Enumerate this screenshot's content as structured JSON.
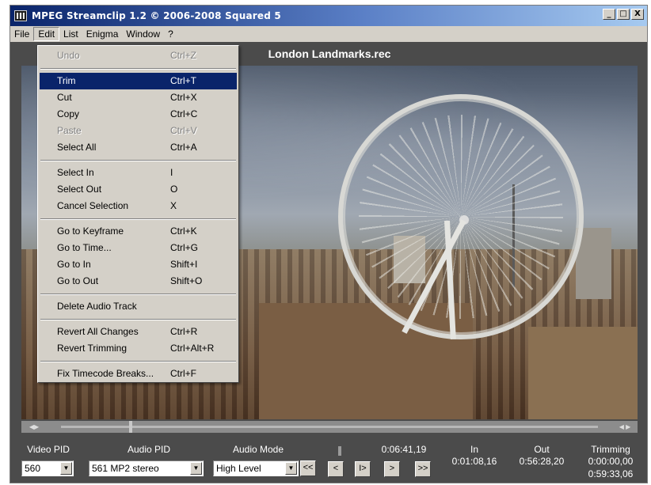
{
  "window": {
    "title": "MPEG Streamclip 1.2  ©  2006-2008 Squared 5",
    "buttons": [
      "_",
      "□",
      "X"
    ]
  },
  "menubar": [
    "File",
    "Edit",
    "List",
    "Enigma",
    "Window",
    "?"
  ],
  "video_title": "London Landmarks.rec",
  "edit_menu": {
    "items": [
      {
        "label": "Undo",
        "shortcut": "Ctrl+Z",
        "state": "disabled"
      },
      {
        "sep": true
      },
      {
        "label": "Trim",
        "shortcut": "Ctrl+T",
        "state": "highlighted"
      },
      {
        "label": "Cut",
        "shortcut": "Ctrl+X",
        "state": "enabled"
      },
      {
        "label": "Copy",
        "shortcut": "Ctrl+C",
        "state": "enabled"
      },
      {
        "label": "Paste",
        "shortcut": "Ctrl+V",
        "state": "disabled"
      },
      {
        "label": "Select All",
        "shortcut": "Ctrl+A",
        "state": "enabled"
      },
      {
        "sep": true
      },
      {
        "label": "Select In",
        "shortcut": "I",
        "state": "enabled"
      },
      {
        "label": "Select Out",
        "shortcut": "O",
        "state": "enabled"
      },
      {
        "label": "Cancel Selection",
        "shortcut": "X",
        "state": "enabled"
      },
      {
        "sep": true
      },
      {
        "label": "Go to Keyframe",
        "shortcut": "Ctrl+K",
        "state": "enabled"
      },
      {
        "label": "Go to Time...",
        "shortcut": "Ctrl+G",
        "state": "enabled"
      },
      {
        "label": "Go to In",
        "shortcut": "Shift+I",
        "state": "enabled"
      },
      {
        "label": "Go to Out",
        "shortcut": "Shift+O",
        "state": "enabled"
      },
      {
        "sep": true
      },
      {
        "label": "Delete Audio Track",
        "shortcut": "",
        "state": "enabled"
      },
      {
        "sep": true
      },
      {
        "label": "Revert All Changes",
        "shortcut": "Ctrl+R",
        "state": "enabled"
      },
      {
        "label": "Revert Trimming",
        "shortcut": "Ctrl+Alt+R",
        "state": "enabled"
      },
      {
        "sep": true
      },
      {
        "label": "Fix Timecode Breaks...",
        "shortcut": "Ctrl+F",
        "state": "enabled"
      }
    ]
  },
  "controls": {
    "video_pid_label": "Video PID",
    "video_pid_value": "560",
    "audio_pid_label": "Audio PID",
    "audio_pid_value": "561 MP2 stereo",
    "audio_mode_label": "Audio Mode",
    "audio_mode_value": "High Level",
    "current_time": "0:06:41,19",
    "in_label": "In",
    "in_value": "0:01:08,16",
    "out_label": "Out",
    "out_value": "0:56:28,20",
    "trimming_label": "Trimming",
    "trimming_value": "0:00:00,00",
    "trimming_duration": "0:59:33,06",
    "buttons": [
      "<<",
      "<",
      "I>",
      ">",
      ">>"
    ]
  }
}
